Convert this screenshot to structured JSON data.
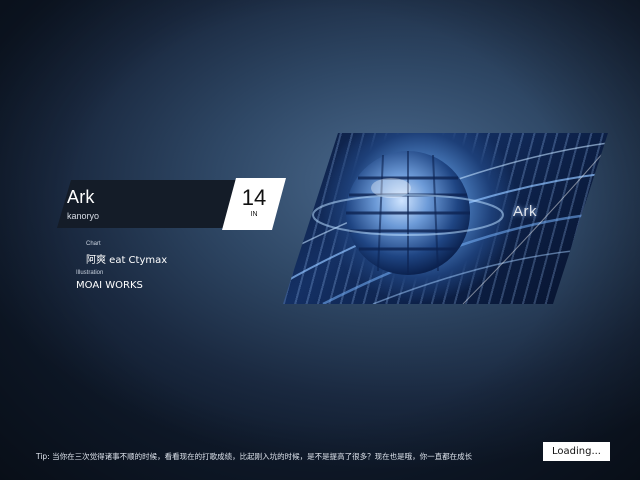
{
  "song": {
    "title": "Ark",
    "artist": "kanoryo",
    "level": "14",
    "difficulty": "IN"
  },
  "credits": {
    "chart_label": "Chart",
    "chart_value": "阿爽 eat Ctymax",
    "illustration_label": "Illustration",
    "illustration_value": "MOAI WORKS"
  },
  "illustration": {
    "overlay_title": "Ark"
  },
  "footer": {
    "tip": "Tip: 当你在三次觉得诸事不顺的时候，看看现在的打歌成绩，比起刚入坑的时候，是不是提高了很多？现在也是哦，你一直都在成长",
    "loading": "Loading..."
  },
  "colors": {
    "panel": "#141c28",
    "level_box": "#ffffff",
    "background_center": "#4b6a8e",
    "background_edge": "#0f1a2b"
  }
}
